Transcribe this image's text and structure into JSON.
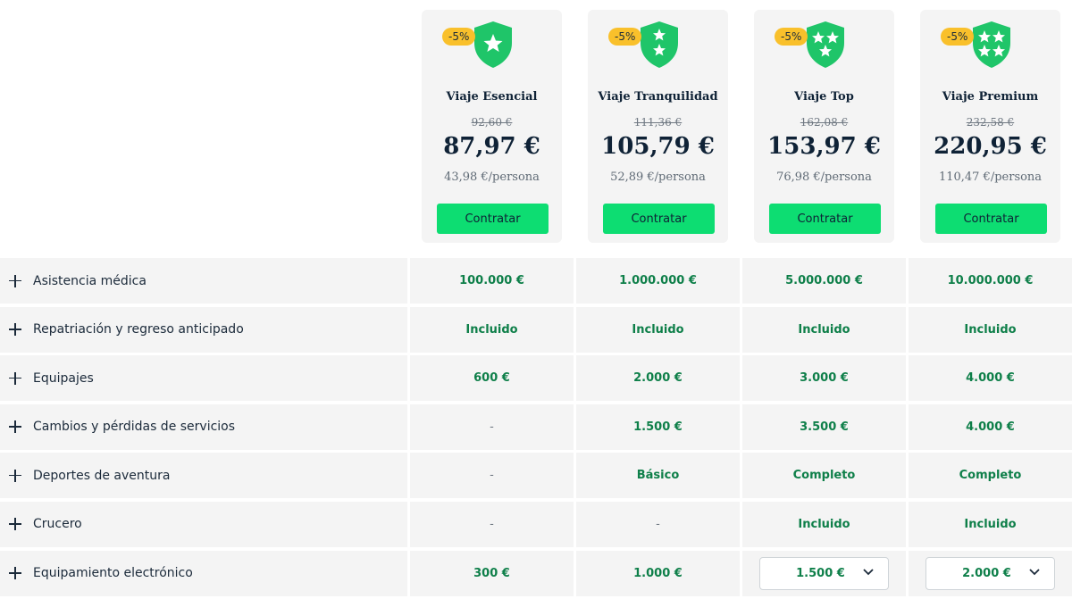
{
  "plans": [
    {
      "name": "Viaje Esencial",
      "discount": "-5%",
      "old_price": "92,60 €",
      "price": "87,97 €",
      "per_person": "43,98 €/persona",
      "cta": "Contratar",
      "stars": 1
    },
    {
      "name": "Viaje Tranquilidad",
      "discount": "-5%",
      "old_price": "111,36 €",
      "price": "105,79 €",
      "per_person": "52,89 €/persona",
      "cta": "Contratar",
      "stars": 2
    },
    {
      "name": "Viaje Top",
      "discount": "-5%",
      "old_price": "162,08 €",
      "price": "153,97 €",
      "per_person": "76,98 €/persona",
      "cta": "Contratar",
      "stars": 3
    },
    {
      "name": "Viaje Premium",
      "discount": "-5%",
      "old_price": "232,58 €",
      "price": "220,95 €",
      "per_person": "110,47 €/persona",
      "cta": "Contratar",
      "stars": 4
    }
  ],
  "coverages": [
    {
      "label": "Asistencia médica",
      "values": [
        "100.000 €",
        "1.000.000 €",
        "5.000.000 €",
        "10.000.000 €"
      ]
    },
    {
      "label": "Repatriación y regreso anticipado",
      "values": [
        "Incluido",
        "Incluido",
        "Incluido",
        "Incluido"
      ]
    },
    {
      "label": "Equipajes",
      "values": [
        "600 €",
        "2.000 €",
        "3.000 €",
        "4.000 €"
      ]
    },
    {
      "label": "Cambios y pérdidas de servicios",
      "values": [
        "-",
        "1.500 €",
        "3.500 €",
        "4.000 €"
      ]
    },
    {
      "label": "Deportes de aventura",
      "values": [
        "-",
        "Básico",
        "Completo",
        "Completo"
      ]
    },
    {
      "label": "Crucero",
      "values": [
        "-",
        "-",
        "Incluido",
        "Incluido"
      ]
    },
    {
      "label": "Equipamiento electrónico",
      "values": [
        "300 €",
        "1.000 €",
        "1.500 €",
        "2.000 €"
      ]
    }
  ],
  "colors": {
    "accent_green": "#0ddd72",
    "value_green": "#0e7f49",
    "badge_yellow": "#f9c02b",
    "shield_green": "#1fc569"
  }
}
